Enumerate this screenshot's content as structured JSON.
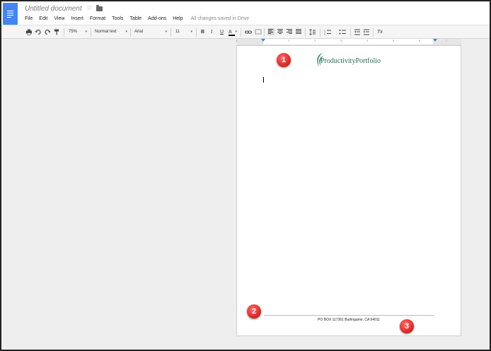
{
  "app": {
    "doc_title": "Untitled document",
    "status": "All changes saved in Drive",
    "icons": [
      "docs-logo-icon",
      "star-icon",
      "folder-icon"
    ]
  },
  "menu": [
    "File",
    "Edit",
    "View",
    "Insert",
    "Format",
    "Tools",
    "Table",
    "Add-ons",
    "Help"
  ],
  "toolbar": {
    "zoom": "75%",
    "style": "Normal text",
    "font": "Arial",
    "size": "11",
    "bold": "B",
    "italic": "I",
    "underline": "U",
    "text_color": "A",
    "clear_format": "Tx"
  },
  "ruler": {
    "marks": [
      "1",
      "1",
      "2",
      "3",
      "4",
      "5",
      "6",
      "7"
    ]
  },
  "document": {
    "logo_text": "ProductivityPortfolio",
    "footer": "PO BOX 117361 Burlingame, CA 94011",
    "logo_color": "#1f6f56"
  },
  "callouts": [
    "1",
    "2",
    "3"
  ],
  "colors": {
    "docs_blue": "#4285f4",
    "callout_red": "#d9211b"
  }
}
